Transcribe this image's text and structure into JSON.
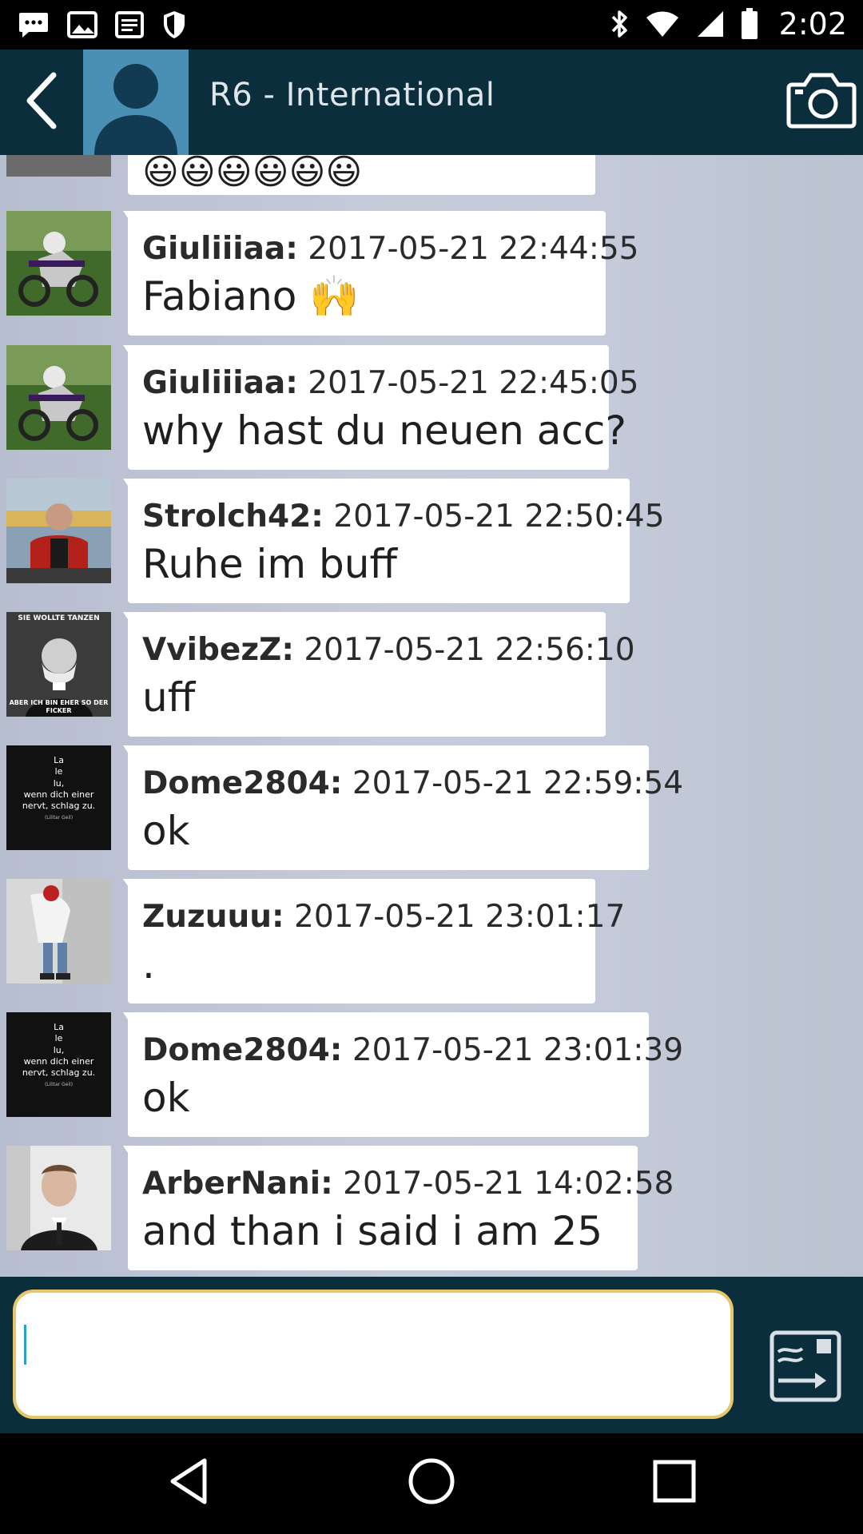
{
  "status_bar": {
    "time": "2:02",
    "left_icons": [
      "chat-bubble-icon",
      "image-icon",
      "list-icon",
      "shield-icon"
    ],
    "right_icons": [
      "bluetooth-icon",
      "wifi-icon",
      "signal-icon",
      "battery-icon"
    ]
  },
  "header": {
    "title": "R6 - International",
    "back_icon": "chevron-left-icon",
    "camera_icon": "camera-icon",
    "avatar_icon": "person-silhouette-icon"
  },
  "messages": [
    {
      "user": "",
      "timestamp": "",
      "text": "😃😃😃😃😃😃",
      "avatar": "partial"
    },
    {
      "user": "Giuliiiaa:",
      "timestamp": "2017-05-21 22:44:55",
      "text": "Fabiano 🙌",
      "avatar": "motocross"
    },
    {
      "user": "Giuliiiaa:",
      "timestamp": "2017-05-21 22:45:05",
      "text": "why hast du neuen acc?",
      "avatar": "motocross"
    },
    {
      "user": "Strolch42:",
      "timestamp": "2017-05-21 22:50:45",
      "text": "Ruhe im buff",
      "avatar": "street-man"
    },
    {
      "user": "VvibezZ:",
      "timestamp": "2017-05-21 22:56:10",
      "text": "uff",
      "avatar": "meme",
      "avatar_caption_top": "SIE WOLLTE TANZEN",
      "avatar_caption_bottom": "ABER ICH BIN EHER SO DER FICKER"
    },
    {
      "user": "Dome2804:",
      "timestamp": "2017-05-21 22:59:54",
      "text": "ok",
      "avatar": "quote",
      "avatar_quote": [
        "La",
        "le",
        "lu,",
        "wenn dich einer",
        "nervt, schlag zu."
      ],
      "avatar_credit": "(Lilitar Geil)"
    },
    {
      "user": "Zuzuuu:",
      "timestamp": "2017-05-21 23:01:17",
      "text": ".",
      "avatar": "photo-legs"
    },
    {
      "user": "Dome2804:",
      "timestamp": "2017-05-21 23:01:39",
      "text": "ok",
      "avatar": "quote",
      "avatar_quote": [
        "La",
        "le",
        "lu,",
        "wenn dich einer",
        "nervt, schlag zu."
      ],
      "avatar_credit": "(Lilitar Geil)"
    },
    {
      "user": "ArberNani:",
      "timestamp": "2017-05-21 14:02:58",
      "text": "and than i said i am 25",
      "avatar": "portrait"
    }
  ],
  "composer": {
    "value": "",
    "placeholder": "",
    "send_icon": "send-message-icon"
  },
  "nav": {
    "back_icon": "nav-back-icon",
    "home_icon": "nav-home-icon",
    "recents_icon": "nav-recents-icon"
  },
  "colors": {
    "app_bar": "#0b2e3c",
    "avatar_bg": "#4a8fb4",
    "chat_bg": "#c4cad9",
    "input_border": "#e7c66a"
  }
}
